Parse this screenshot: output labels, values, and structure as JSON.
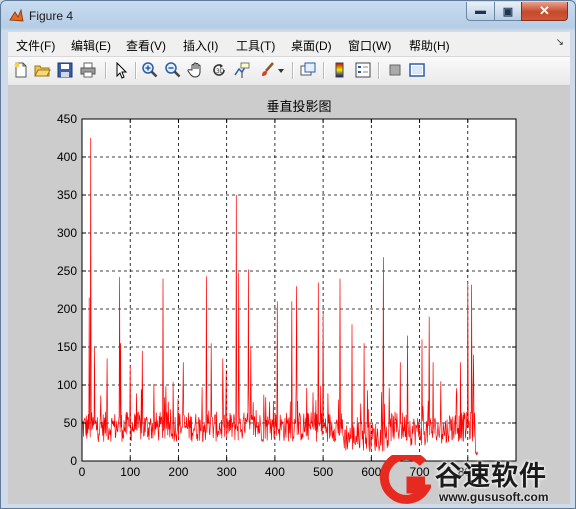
{
  "window": {
    "title": "Figure 4"
  },
  "menu": [
    "文件(F)",
    "编辑(E)",
    "查看(V)",
    "插入(I)",
    "工具(T)",
    "桌面(D)",
    "窗口(W)",
    "帮助(H)"
  ],
  "toolbar_icons": [
    "new-file-icon",
    "open-folder-icon",
    "save-icon",
    "print-icon",
    "arrow-pointer-icon",
    "zoom-in-icon",
    "zoom-out-icon",
    "pan-hand-icon",
    "rotate-3d-icon",
    "data-cursor-icon",
    "brush-icon",
    "brush-dropdown-icon",
    "link-plot-icon",
    "colorbar-icon",
    "legend-icon",
    "hide-plot-tools-icon",
    "show-plot-tools-icon"
  ],
  "chart_data": {
    "type": "line",
    "title": "垂直投影图",
    "xlim": [
      0,
      900
    ],
    "ylim": [
      0,
      450
    ],
    "xticks": [
      0,
      100,
      200,
      300,
      400,
      500,
      600,
      700,
      800
    ],
    "yticks": [
      0,
      50,
      100,
      150,
      200,
      250,
      300,
      350,
      400,
      450
    ],
    "grid": true,
    "series": [
      {
        "color": "#ff0000",
        "baseline": 45,
        "x_range": [
          0,
          815
        ],
        "spikes": [
          [
            18,
            425
          ],
          [
            15,
            215
          ],
          [
            26,
            150
          ],
          [
            52,
            135
          ],
          [
            78,
            242
          ],
          [
            80,
            155
          ],
          [
            100,
            125
          ],
          [
            125,
            145
          ],
          [
            168,
            240
          ],
          [
            210,
            130
          ],
          [
            258,
            243
          ],
          [
            268,
            155
          ],
          [
            292,
            135
          ],
          [
            320,
            350
          ],
          [
            325,
            248
          ],
          [
            345,
            252
          ],
          [
            350,
            150
          ],
          [
            405,
            210
          ],
          [
            435,
            210
          ],
          [
            445,
            230
          ],
          [
            490,
            235
          ],
          [
            500,
            193
          ],
          [
            535,
            240
          ],
          [
            560,
            180
          ],
          [
            585,
            155
          ],
          [
            625,
            268
          ],
          [
            660,
            130
          ],
          [
            675,
            165
          ],
          [
            705,
            160
          ],
          [
            720,
            190
          ],
          [
            728,
            130
          ],
          [
            785,
            130
          ],
          [
            800,
            235
          ],
          [
            808,
            232
          ],
          [
            812,
            140
          ]
        ]
      }
    ]
  },
  "watermark": {
    "name": "谷速软件",
    "url": "www.gususoft.com"
  }
}
